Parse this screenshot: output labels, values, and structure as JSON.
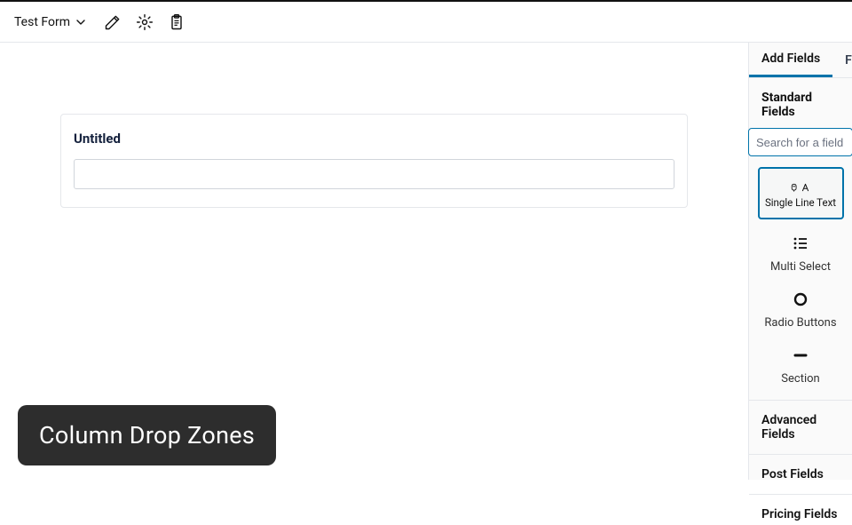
{
  "header": {
    "form_name": "Test Form"
  },
  "canvas": {
    "field_label": "Untitled",
    "field_value": ""
  },
  "sidebar": {
    "tabs": {
      "add_fields": "Add Fields",
      "field": "Fiel"
    },
    "sections": {
      "standard_fields": "Standard Fields",
      "advanced_fields": "Advanced Fields",
      "post_fields": "Post Fields",
      "pricing_fields": "Pricing Fields"
    },
    "search": {
      "placeholder": "Search for a field"
    },
    "palette": {
      "single_line_text": "Single Line Text",
      "multi_select": "Multi Select",
      "radio_buttons": "Radio Buttons",
      "section": "Section"
    }
  },
  "overlay": {
    "text": "Column Drop Zones"
  }
}
